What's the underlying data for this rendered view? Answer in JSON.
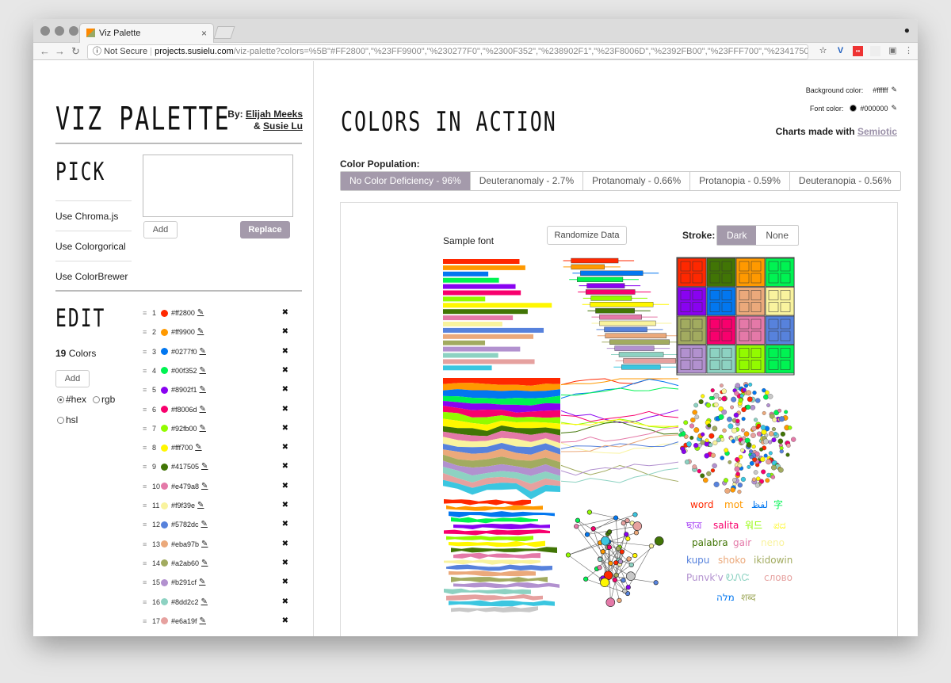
{
  "browser": {
    "tab_title": "Viz Palette",
    "tab_close": "×",
    "security_label": "Not Secure",
    "url_host": "projects.susielu.com",
    "url_rest": "/viz-palette?colors=%5B\"#FF2800\",\"%23FF9900\",\"%230277F0\",\"%2300F352\",\"%238902F1\",\"%23F8006D\",\"%2392FB00\",\"%23FFF700\",\"%23417505\",\"%23..."
  },
  "header": {
    "logo": "VIZ PALETTE",
    "by_prefix": "By: ",
    "author1": "Elijah Meeks",
    "author_join": "& ",
    "author2": "Susie Lu"
  },
  "pick": {
    "heading": "PICK",
    "links": [
      "Use Chroma.js",
      "Use Colorgorical",
      "Use ColorBrewer"
    ],
    "add_label": "Add",
    "replace_label": "Replace",
    "textarea_value": ""
  },
  "edit": {
    "heading": "EDIT",
    "count": "19",
    "count_suffix": " Colors",
    "add_label": "Add",
    "formats": [
      "#hex",
      "rgb",
      "hsl"
    ],
    "selected_format": "#hex",
    "colors": [
      {
        "n": "1",
        "hex": "#ff2800",
        "c": "#ff2800"
      },
      {
        "n": "2",
        "hex": "#ff9900",
        "c": "#ff9900"
      },
      {
        "n": "3",
        "hex": "#0277f0",
        "c": "#0277f0"
      },
      {
        "n": "4",
        "hex": "#00f352",
        "c": "#00f352"
      },
      {
        "n": "5",
        "hex": "#8902f1",
        "c": "#8902f1"
      },
      {
        "n": "6",
        "hex": "#f8006d",
        "c": "#f8006d"
      },
      {
        "n": "7",
        "hex": "#92fb00",
        "c": "#92fb00"
      },
      {
        "n": "8",
        "hex": "#fff700",
        "c": "#fff700"
      },
      {
        "n": "9",
        "hex": "#417505",
        "c": "#417505"
      },
      {
        "n": "10",
        "hex": "#e479a8",
        "c": "#e479a8"
      },
      {
        "n": "11",
        "hex": "#f9f39e",
        "c": "#f9f39e"
      },
      {
        "n": "12",
        "hex": "#5782dc",
        "c": "#5782dc"
      },
      {
        "n": "13",
        "hex": "#eba97b",
        "c": "#eba97b"
      },
      {
        "n": "14",
        "hex": "#a2ab60",
        "c": "#a2ab60"
      },
      {
        "n": "15",
        "hex": "#b291cf",
        "c": "#b291cf"
      },
      {
        "n": "16",
        "hex": "#8dd2c2",
        "c": "#8dd2c2"
      },
      {
        "n": "17",
        "hex": "#e6a19f",
        "c": "#e6a19f"
      }
    ]
  },
  "main": {
    "heading": "COLORS IN ACTION",
    "bg_label": "Background color:",
    "bg_value": "#ffffff",
    "font_label": "Font color:",
    "font_value": "#000000",
    "charts_made_with": "Charts made with ",
    "semiotic": "Semiotic",
    "population_label": "Color Population:",
    "population_tabs": [
      "No Color Deficiency - 96%",
      "Deuteranomaly - 2.7%",
      "Protanomaly - 0.66%",
      "Protanopia - 0.59%",
      "Deuteranopia - 0.56%"
    ],
    "active_population": 0,
    "sample_font": "Sample font",
    "randomize": "Randomize Data",
    "stroke_label": "Stroke:",
    "stroke_options": [
      "Dark",
      "None"
    ],
    "stroke_selected": "Dark",
    "words": [
      {
        "t": "word",
        "c": "#ff2800"
      },
      {
        "t": "mot",
        "c": "#ff9900"
      },
      {
        "t": "لفظ",
        "c": "#0277f0"
      },
      {
        "t": "字",
        "c": "#00f352"
      },
      {
        "t": "ছাত্র",
        "c": "#8902f1"
      },
      {
        "t": "salita",
        "c": "#f8006d"
      },
      {
        "t": "워드",
        "c": "#92fb00"
      },
      {
        "t": "ಪದ",
        "c": "#fff700"
      },
      {
        "t": "palabra",
        "c": "#417505"
      },
      {
        "t": "gair",
        "c": "#e479a8"
      },
      {
        "t": "neno",
        "c": "#f9f39e"
      },
      {
        "t": "kupu",
        "c": "#5782dc"
      },
      {
        "t": "shoko",
        "c": "#eba97b"
      },
      {
        "t": "ikidowin",
        "c": "#a2ab60"
      },
      {
        "t": "Punvk'v",
        "c": "#b291cf"
      },
      {
        "t": "ᎧᏁᏨ",
        "c": "#8dd2c2"
      },
      {
        "t": "слово",
        "c": "#e6a19f"
      },
      {
        "t": "מלה",
        "c": "#0277f0"
      },
      {
        "t": "शब्द",
        "c": "#a2ab60"
      }
    ]
  },
  "palette": [
    "#ff2800",
    "#ff9900",
    "#0277f0",
    "#00f352",
    "#8902f1",
    "#f8006d",
    "#92fb00",
    "#fff700",
    "#417505",
    "#e479a8",
    "#f9f39e",
    "#5782dc",
    "#eba97b",
    "#a2ab60",
    "#b291cf",
    "#8dd2c2",
    "#e6a19f",
    "#3bc6e0",
    "#c8c8c8"
  ]
}
